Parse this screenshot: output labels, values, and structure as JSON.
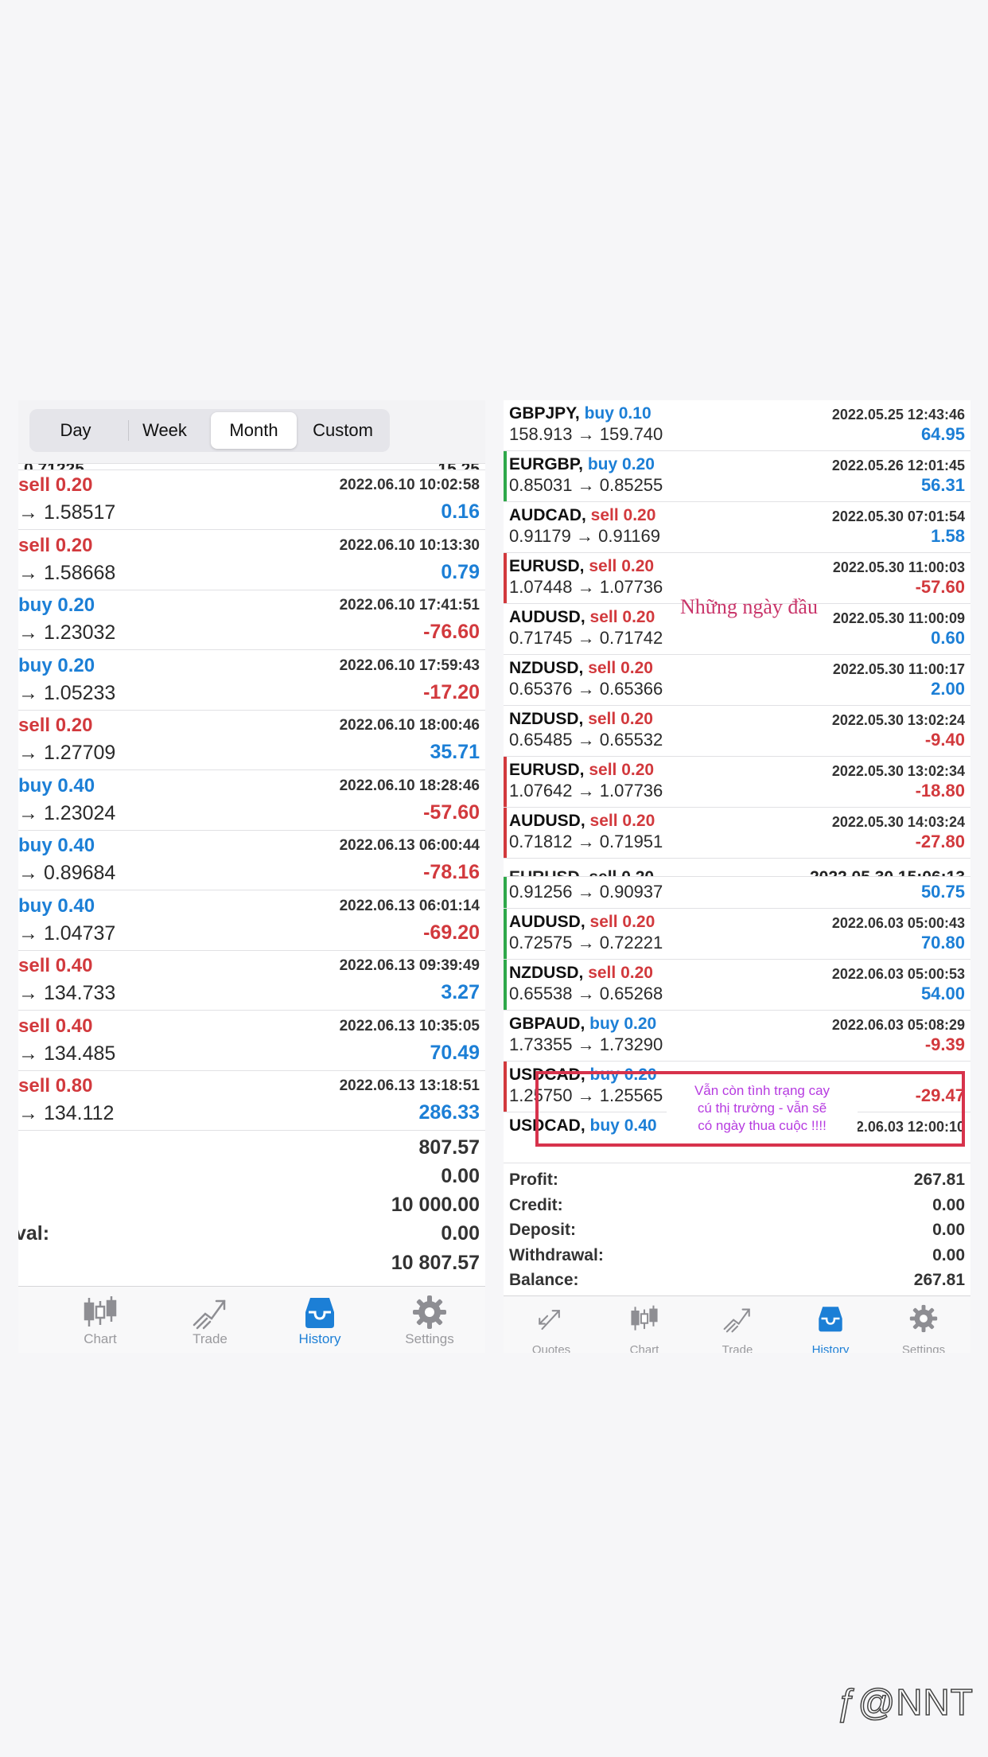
{
  "left": {
    "filters": [
      "Day",
      "Week",
      "Month",
      "Custom"
    ],
    "active_filter": "Month",
    "rows": [
      {
        "side": "sell",
        "lot": "0.20",
        "time": "2022.06.10 10:02:58",
        "prices": "→ 1.58517",
        "profit": "0.16"
      },
      {
        "side": "sell",
        "lot": "0.20",
        "time": "2022.06.10 10:13:30",
        "prices": "→ 1.58668",
        "profit": "0.79"
      },
      {
        "side": "buy",
        "lot": "0.20",
        "time": "2022.06.10 17:41:51",
        "prices": "→ 1.23032",
        "profit": "-76.60"
      },
      {
        "side": "buy",
        "lot": "0.20",
        "time": "2022.06.10 17:59:43",
        "prices": "→ 1.05233",
        "profit": "-17.20"
      },
      {
        "side": "sell",
        "lot": "0.20",
        "time": "2022.06.10 18:00:46",
        "prices": "→ 1.27709",
        "profit": "35.71"
      },
      {
        "side": "buy",
        "lot": "0.40",
        "time": "2022.06.10 18:28:46",
        "prices": "→ 1.23024",
        "profit": "-57.60"
      },
      {
        "side": "buy",
        "lot": "0.40",
        "time": "2022.06.13 06:00:44",
        "prices": "→ 0.89684",
        "profit": "-78.16"
      },
      {
        "side": "buy",
        "lot": "0.40",
        "time": "2022.06.13 06:01:14",
        "prices": "→ 1.04737",
        "profit": "-69.20"
      },
      {
        "side": "sell",
        "lot": "0.40",
        "time": "2022.06.13 09:39:49",
        "prices": "→ 134.733",
        "profit": "3.27"
      },
      {
        "side": "sell",
        "lot": "0.40",
        "time": "2022.06.13 10:35:05",
        "prices": "→ 134.485",
        "profit": "70.49"
      },
      {
        "side": "sell",
        "lot": "0.80",
        "time": "2022.06.13 13:18:51",
        "prices": "→ 134.112",
        "profit": "286.33"
      }
    ],
    "summary": {
      "profit": "807.57",
      "credit": "0.00",
      "deposit": "10 000.00",
      "withdrawal_label": "val:",
      "withdrawal": "0.00",
      "balance": "10 807.57"
    },
    "tabs": [
      "Chart",
      "Trade",
      "History",
      "Settings"
    ],
    "active_tab": "History"
  },
  "right": {
    "rows": [
      {
        "symbol": "GBPJPY,",
        "side": "buy",
        "lot": "0.10",
        "time": "2022.05.25 12:43:46",
        "prices": "158.913 → 159.740",
        "profit": "64.95",
        "mark": ""
      },
      {
        "symbol": "EURGBP,",
        "side": "buy",
        "lot": "0.20",
        "time": "2022.05.26 12:01:45",
        "prices": "0.85031 → 0.85255",
        "profit": "56.31",
        "mark": "green"
      },
      {
        "symbol": "AUDCAD,",
        "side": "sell",
        "lot": "0.20",
        "time": "2022.05.30 07:01:54",
        "prices": "0.91179 → 0.91169",
        "profit": "1.58",
        "mark": ""
      },
      {
        "symbol": "EURUSD,",
        "side": "sell",
        "lot": "0.20",
        "time": "2022.05.30 11:00:03",
        "prices": "1.07448 → 1.07736",
        "profit": "-57.60",
        "mark": "red"
      },
      {
        "symbol": "AUDUSD,",
        "side": "sell",
        "lot": "0.20",
        "time": "2022.05.30 11:00:09",
        "prices": "0.71745 → 0.71742",
        "profit": "0.60",
        "mark": ""
      },
      {
        "symbol": "NZDUSD,",
        "side": "sell",
        "lot": "0.20",
        "time": "2022.05.30 11:00:17",
        "prices": "0.65376 → 0.65366",
        "profit": "2.00",
        "mark": ""
      },
      {
        "symbol": "NZDUSD,",
        "side": "sell",
        "lot": "0.20",
        "time": "2022.05.30 13:02:24",
        "prices": "0.65485 → 0.65532",
        "profit": "-9.40",
        "mark": ""
      },
      {
        "symbol": "EURUSD,",
        "side": "sell",
        "lot": "0.20",
        "time": "2022.05.30 13:02:34",
        "prices": "1.07642 → 1.07736",
        "profit": "-18.80",
        "mark": "red"
      },
      {
        "symbol": "AUDUSD,",
        "side": "sell",
        "lot": "0.20",
        "time": "2022.05.30 14:03:24",
        "prices": "0.71812 → 0.71951",
        "profit": "-27.80",
        "mark": "red"
      }
    ],
    "rows2": [
      {
        "symbol": "",
        "side": "",
        "lot": "",
        "time": "",
        "prices": "0.91256 → 0.90937",
        "profit": "50.75",
        "mark": "green"
      },
      {
        "symbol": "AUDUSD,",
        "side": "sell",
        "lot": "0.20",
        "time": "2022.06.03 05:00:43",
        "prices": "0.72575 → 0.72221",
        "profit": "70.80",
        "mark": "green"
      },
      {
        "symbol": "NZDUSD,",
        "side": "sell",
        "lot": "0.20",
        "time": "2022.06.03 05:00:53",
        "prices": "0.65538 → 0.65268",
        "profit": "54.00",
        "mark": "green"
      },
      {
        "symbol": "GBPAUD,",
        "side": "buy",
        "lot": "0.20",
        "time": "2022.06.03 05:08:29",
        "prices": "1.73355 → 1.73290",
        "profit": "-9.39",
        "mark": ""
      },
      {
        "symbol": "USDCAD,",
        "side": "buy",
        "lot": "0.20",
        "time": "",
        "prices": "1.25750 → 1.25565",
        "profit": "-29.47",
        "mark": "red"
      },
      {
        "symbol": "USDCAD,",
        "side": "buy",
        "lot": "0.40",
        "time": "2022.06.03 12:00:10",
        "prices": "",
        "profit": "",
        "mark": ""
      }
    ],
    "summary": [
      {
        "label": "Profit:",
        "value": "267.81"
      },
      {
        "label": "Credit:",
        "value": "0.00"
      },
      {
        "label": "Deposit:",
        "value": "0.00"
      },
      {
        "label": "Withdrawal:",
        "value": "0.00"
      },
      {
        "label": "Balance:",
        "value": "267.81"
      }
    ],
    "tabs": [
      "Quotes",
      "Chart",
      "Trade",
      "History",
      "Settings"
    ],
    "active_tab": "History"
  },
  "annotations": {
    "first_days": "Những ngày đầu",
    "box_note_line1": "Vẫn còn tình trạng cay",
    "box_note_line2": "cú thị trường - vẫn sẽ",
    "box_note_line3": "có ngày thua cuộc !!!!",
    "watermark": "@NNT"
  },
  "colors": {
    "sell": "#d2393d",
    "buy": "#1c7fd6",
    "accent": "#1c7fd6",
    "note_box": "#d7334c"
  }
}
